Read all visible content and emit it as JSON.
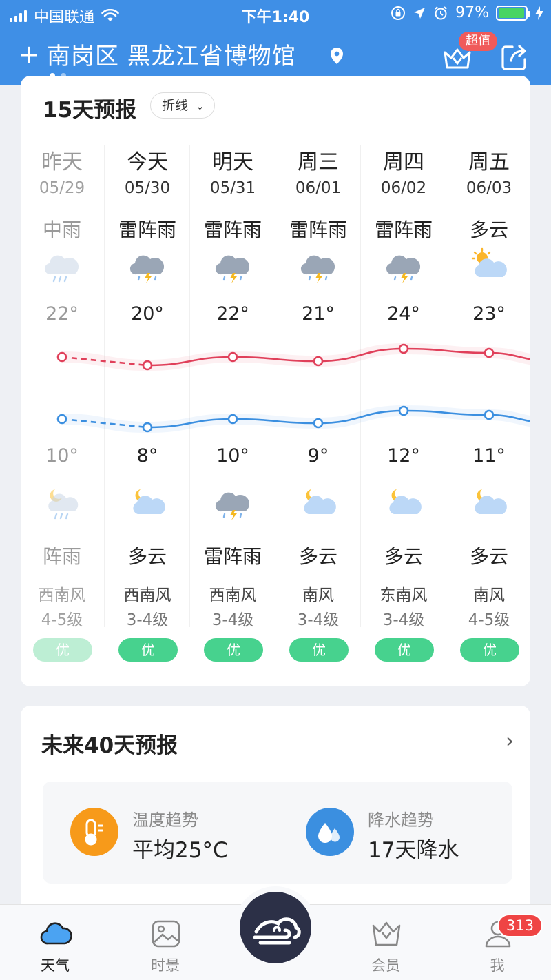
{
  "status_bar": {
    "carrier": "中国联通",
    "time": "下午1:40",
    "battery_percent": "97%",
    "battery_level": 0.97
  },
  "header": {
    "add_icon": "plus-icon",
    "location": "南岗区 黑龙江省博物馆",
    "vip_badge": "超值",
    "page_count": 2,
    "active_page": 1
  },
  "forecast15": {
    "title": "15天预报",
    "view_toggle": "折线",
    "days": [
      {
        "day": "昨天",
        "date": "05/29",
        "day_weather": "中雨",
        "day_icon": "rain",
        "high": "22°",
        "high_value": 22,
        "low": "10°",
        "low_value": 10,
        "night_icon": "night-rain",
        "night_weather": "阵雨",
        "wind": "西南风",
        "wind_level": "4-5级",
        "aqi": "优",
        "past": true
      },
      {
        "day": "今天",
        "date": "05/30",
        "day_weather": "雷阵雨",
        "day_icon": "thunder",
        "high": "20°",
        "high_value": 20,
        "low": "8°",
        "low_value": 8,
        "night_icon": "night-cloudy",
        "night_weather": "多云",
        "wind": "西南风",
        "wind_level": "3-4级",
        "aqi": "优",
        "past": false
      },
      {
        "day": "明天",
        "date": "05/31",
        "day_weather": "雷阵雨",
        "day_icon": "thunder",
        "high": "22°",
        "high_value": 22,
        "low": "10°",
        "low_value": 10,
        "night_icon": "thunder",
        "night_weather": "雷阵雨",
        "wind": "西南风",
        "wind_level": "3-4级",
        "aqi": "优",
        "past": false
      },
      {
        "day": "周三",
        "date": "06/01",
        "day_weather": "雷阵雨",
        "day_icon": "thunder",
        "high": "21°",
        "high_value": 21,
        "low": "9°",
        "low_value": 9,
        "night_icon": "night-cloudy",
        "night_weather": "多云",
        "wind": "南风",
        "wind_level": "3-4级",
        "aqi": "优",
        "past": false
      },
      {
        "day": "周四",
        "date": "06/02",
        "day_weather": "雷阵雨",
        "day_icon": "thunder",
        "high": "24°",
        "high_value": 24,
        "low": "12°",
        "low_value": 12,
        "night_icon": "night-cloudy",
        "night_weather": "多云",
        "wind": "东南风",
        "wind_level": "3-4级",
        "aqi": "优",
        "past": false
      },
      {
        "day": "周五",
        "date": "06/03",
        "day_weather": "多云",
        "day_icon": "sun-cloudy",
        "high": "23°",
        "high_value": 23,
        "low": "11°",
        "low_value": 11,
        "night_icon": "night-cloudy",
        "night_weather": "多云",
        "wind": "南风",
        "wind_level": "4-5级",
        "aqi": "优",
        "past": false
      }
    ],
    "colors": {
      "high_line": "#e0405a",
      "low_line": "#3b8fe0",
      "aqi_good": "#47d28e"
    }
  },
  "forecast40": {
    "title": "未来40天预报",
    "temperature_trend": {
      "label": "温度趋势",
      "value": "平均25°C",
      "icon": "thermometer-icon",
      "color": "#f79a1a"
    },
    "precip_trend": {
      "label": "降水趋势",
      "value": "17天降水",
      "icon": "water-drops-icon",
      "color": "#3b8fe0"
    }
  },
  "tabbar": {
    "tabs": [
      {
        "label": "天气",
        "icon": "cloud-icon",
        "active": true
      },
      {
        "label": "时景",
        "icon": "image-icon",
        "active": false
      },
      {
        "label": "",
        "icon": "wind-cloud-logo-icon",
        "active": false
      },
      {
        "label": "会员",
        "icon": "crown-icon",
        "active": false
      },
      {
        "label": "我",
        "icon": "user-icon",
        "active": false
      }
    ],
    "me_badge": "313"
  }
}
